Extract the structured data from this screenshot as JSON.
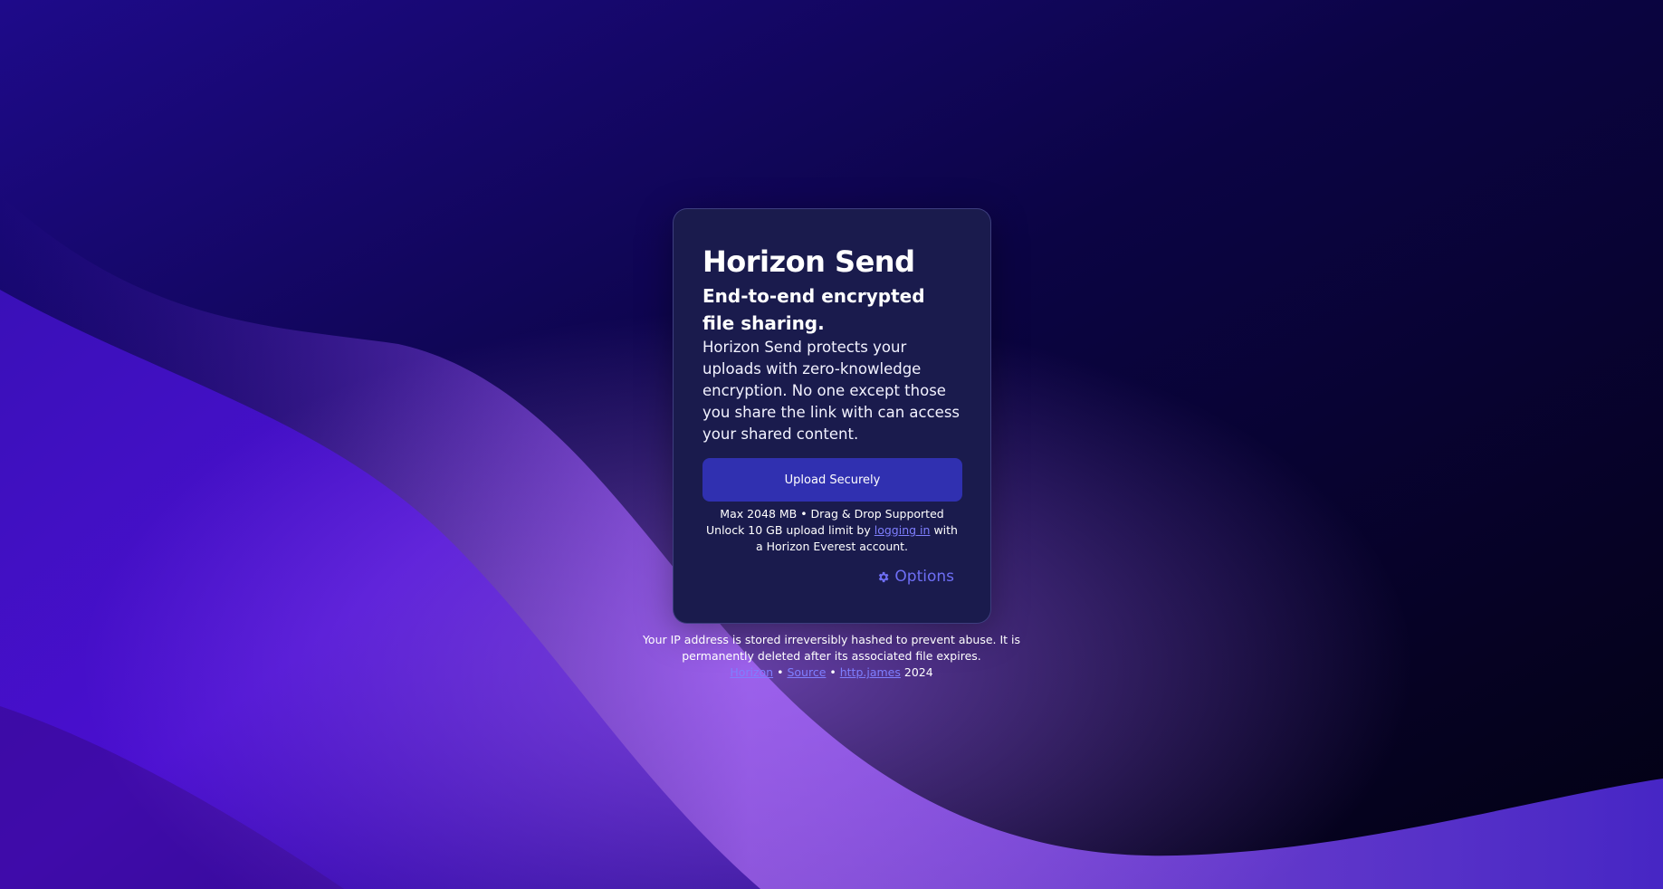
{
  "card": {
    "title": "Horizon Send",
    "subtitle": "End-to-end encrypted file sharing.",
    "description": "Horizon Send protects your uploads with zero-knowledge encryption. No one except those you share the link with can access your shared content.",
    "upload_button": "Upload Securely",
    "limits": "Max 2048 MB • Drag & Drop Supported",
    "unlock_prefix": "Unlock 10 GB upload limit by",
    "login_link": "logging in",
    "unlock_suffix": "with a Horizon Everest account.",
    "options_label": "Options",
    "options_icon": "gear-icon"
  },
  "footer": {
    "notice": "Your IP address is stored irreversibly hashed to prevent abuse. It is permanently deleted after its associated file expires.",
    "link_horizon": "Horizon",
    "separator": "•",
    "link_source": "Source",
    "link_author": "http.james",
    "year": "2024"
  },
  "colors": {
    "card_bg": "#1a1b4d",
    "button_bg": "#3030b0",
    "link": "#7f7fff",
    "options": "#6e6ef5",
    "background_dark": "#06031a",
    "background_wave": "#4a10c8"
  }
}
